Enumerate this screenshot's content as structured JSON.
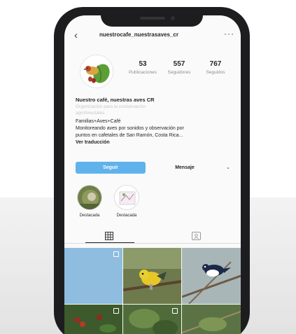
{
  "profile": {
    "username": "nuestrocafe_nuestrasaves_cr",
    "stats": [
      {
        "value": "53",
        "label": "Publicaciones"
      },
      {
        "value": "557",
        "label": "Seguidores"
      },
      {
        "value": "767",
        "label": "Seguidos"
      }
    ],
    "display_name": "Nuestro café, nuestras aves CR",
    "bio_faded": [
      "Organización para la conservación",
      "agroforestales"
    ],
    "bio": [
      "Familias+Aves+Café",
      "Monitoreando aves por sonidos y observación por",
      "puntos en cafetales de San Ramón, Costa Rica..."
    ],
    "translate": "Ver traducción"
  },
  "actions": {
    "follow": "Seguir",
    "message": "Mensaje",
    "dropdown": "⌄"
  },
  "highlights": [
    {
      "label": "Destacada"
    },
    {
      "label": "Destacada"
    }
  ],
  "icons": {
    "back": "‹",
    "more": "···",
    "grid": "grid-icon",
    "tagged": "tagged-icon"
  },
  "colors": {
    "accent": "#5fb2ec",
    "phone": "#1d1d1f"
  }
}
